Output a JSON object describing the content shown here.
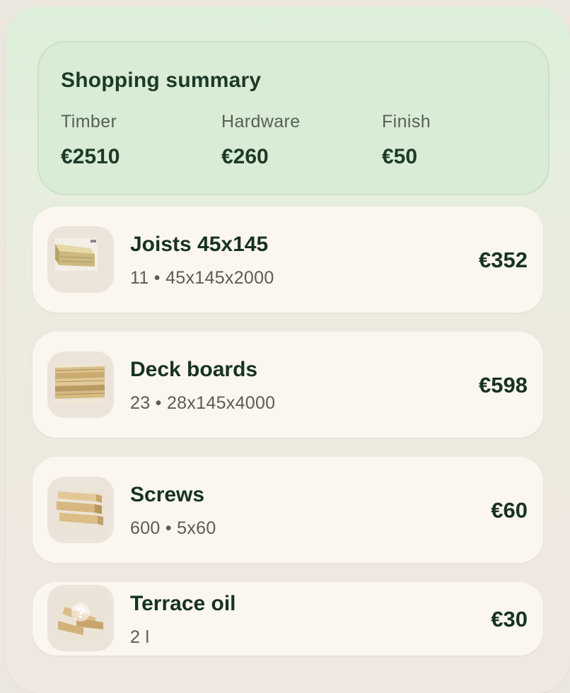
{
  "summary": {
    "title": "Shopping summary",
    "stats": [
      {
        "label": "Timber",
        "value": "€2510"
      },
      {
        "label": "Hardware",
        "value": "€260"
      },
      {
        "label": "Finish",
        "value": "€50"
      }
    ]
  },
  "items": [
    {
      "name": "Joists 45x145",
      "quantity": "11",
      "size": "45x145x2000",
      "detail": "11 • 45x145x2000",
      "price": "€352",
      "image": "joist-image"
    },
    {
      "name": "Deck boards",
      "quantity": "23",
      "size": "28x145x4000",
      "detail": "23 • 28x145x4000",
      "price": "€598",
      "image": "deck-boards-image"
    },
    {
      "name": "Screws",
      "quantity": "600",
      "size": "5x60",
      "detail": "600 • 5x60",
      "price": "€60",
      "image": "timber-stack-image"
    },
    {
      "name": "Terrace oil",
      "quantity": "2 l",
      "detail": "2 l",
      "price": "€30",
      "image": "placeholder-question-image"
    }
  ],
  "colors": {
    "summary_bg": "#d9ecd5",
    "card_bg": "#fbf6ef",
    "text_dark": "#16331f"
  }
}
